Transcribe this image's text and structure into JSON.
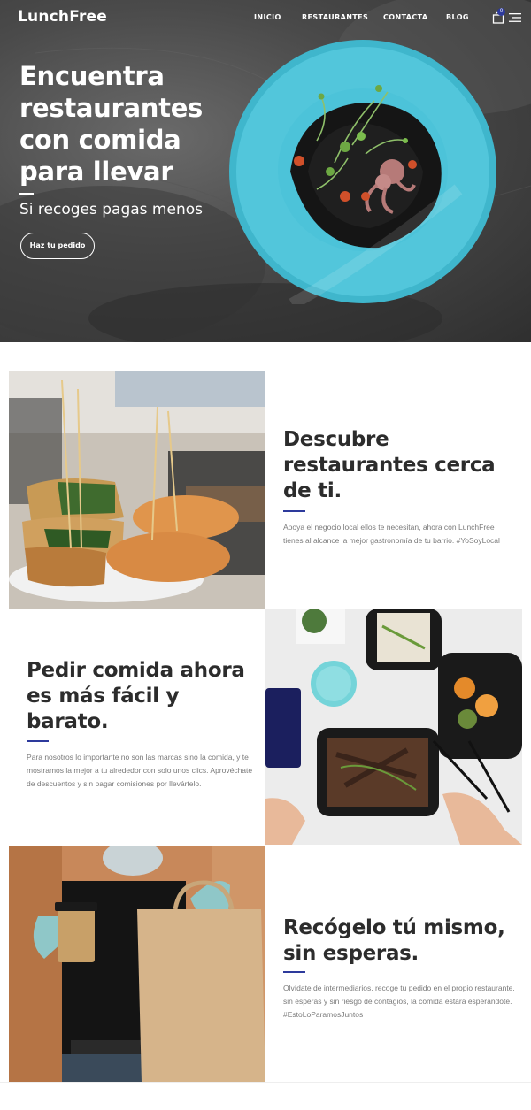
{
  "brand": {
    "name": "LunchFree"
  },
  "nav": {
    "items": [
      {
        "label": "INICIO"
      },
      {
        "label": "RESTAURANTES"
      },
      {
        "label": "CONTACTA"
      },
      {
        "label": "BLOG"
      }
    ],
    "cart_count": "0",
    "icons": [
      "shopping-bag-icon",
      "menu-icon"
    ]
  },
  "hero": {
    "title": "Encuentra restaurantes con comida para llevar",
    "subtitle": "Si recoges pagas menos",
    "cta_label": "Haz tu pedido"
  },
  "features": [
    {
      "title": "Descubre restaurantes cerca de ti.",
      "text": "Apoya el negocio local ellos te necesitan, ahora con LunchFree tienes al alcance la mejor gastronomía de tu barrio. #YoSoyLocal"
    },
    {
      "title": "Pedir comida ahora es más fácil y barato.",
      "text": "Para nosotros lo importante no son las marcas sino la comida, y te mostramos la mejor a tu alrededor con solo unos clics. Aprovéchate de descuentos y sin pagar comisiones por llevártelo."
    },
    {
      "title": "Recógelo tú mismo, sin esperas.",
      "text": "Olvídate de intermediarios, recoge tu pedido en el propio restaurante, sin esperas y sin riesgo de contagios, la comida estará esperándote. #EstoLoParamosJuntos"
    }
  ],
  "colors": {
    "accent": "#2d3a9c",
    "plate": "#4cc3d9",
    "heading": "#2c2c2c",
    "body_text": "#7a7a7a"
  }
}
